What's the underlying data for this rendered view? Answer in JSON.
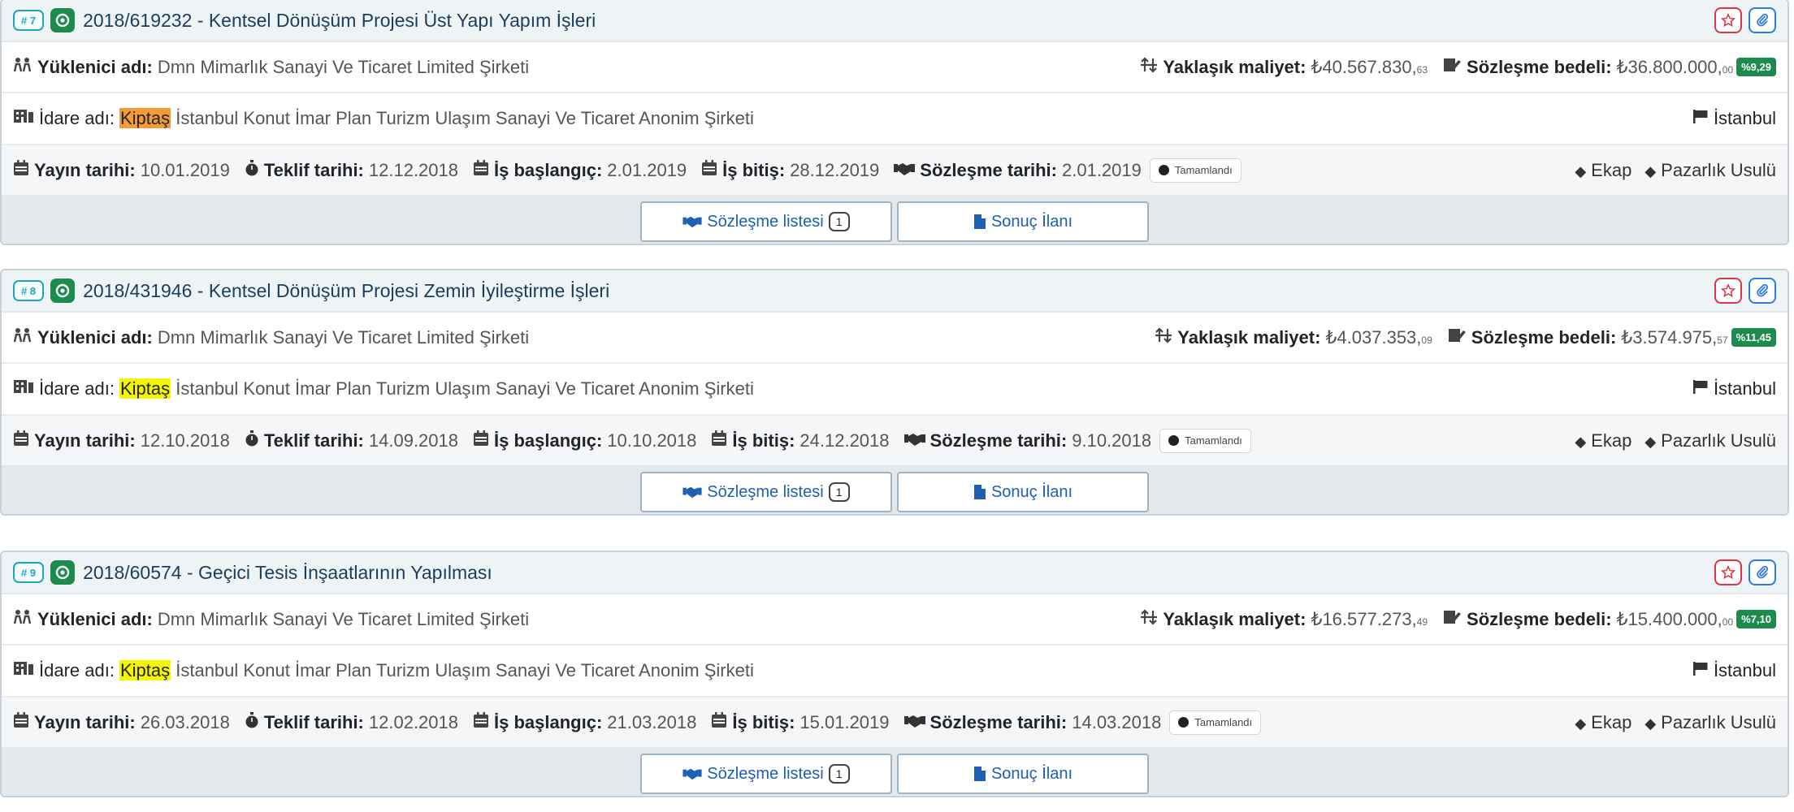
{
  "labels": {
    "contractor": "Yüklenici adı:",
    "approx_cost": "Yaklaşık maliyet:",
    "contract_price": "Sözleşme bedeli:",
    "admin": "İdare adı:",
    "pub_date": "Yayın tarihi:",
    "bid_date": "Teklif tarihi:",
    "start_date": "İş başlangıç:",
    "end_date": "İş bitiş:",
    "contract_date": "Sözleşme tarihi:",
    "contract_list_btn": "Sözleşme listesi",
    "result_btn": "Sonuç İlanı"
  },
  "icons": {
    "contractor": "people-icon",
    "approx_cost": "sort-arrows-icon",
    "contract_price": "signature-icon",
    "admin": "building-icon",
    "city": "flag-icon",
    "date": "calendar-icon",
    "bid": "stopwatch-icon",
    "contract": "handshake-icon",
    "tag": "tag-icon",
    "fav": "star-icon",
    "attach": "paperclip-icon",
    "result": "file-icon",
    "status": "check-circle-icon"
  },
  "colors": {
    "index_badge": "#1fa6b8",
    "status_icon": "#1d8a4e",
    "percent_badge": "#1d8a4e",
    "fav_button": "#dc3545",
    "attach_button": "#2f7bdc",
    "title_text": "#1b3d5c",
    "highlight_selected": "#f69a36",
    "highlight": "#f6f500"
  },
  "cards": [
    {
      "index": "# 7",
      "title": "2018/619232 - Kentsel Dönüşüm Projesi Üst Yapı Yapım İşleri",
      "contractor": "Dmn Mimarlık Sanayi Ve Ticaret Limited Şirketi",
      "approx_cost_main": "₺40.567.830,",
      "approx_cost_cents": "63",
      "contract_price_main": "₺36.800.000,",
      "contract_price_cents": "00",
      "discount_pct": "%9,29",
      "admin_highlight": "Kiptaş",
      "admin_rest": "İstanbul Konut İmar Plan Turizm Ulaşım Sanayi Ve Ticaret Anonim Şirketi",
      "city": "İstanbul",
      "pub_date": "10.01.2019",
      "bid_date": "12.12.2018",
      "start_date": "2.01.2019",
      "end_date": "28.12.2019",
      "contract_date": "2.01.2019",
      "state": "Tamamlandı",
      "tag1": "Ekap",
      "tag2": "Pazarlık Usulü",
      "contract_count": "1"
    },
    {
      "index": "# 8",
      "title": "2018/431946 - Kentsel Dönüşüm Projesi Zemin İyileştirme İşleri",
      "contractor": "Dmn Mimarlık Sanayi Ve Ticaret Limited Şirketi",
      "approx_cost_main": "₺4.037.353,",
      "approx_cost_cents": "09",
      "contract_price_main": "₺3.574.975,",
      "contract_price_cents": "57",
      "discount_pct": "%11,45",
      "admin_highlight": "Kiptaş",
      "admin_rest": "İstanbul Konut İmar Plan Turizm Ulaşım Sanayi Ve Ticaret Anonim Şirketi",
      "city": "İstanbul",
      "pub_date": "12.10.2018",
      "bid_date": "14.09.2018",
      "start_date": "10.10.2018",
      "end_date": "24.12.2018",
      "contract_date": "9.10.2018",
      "state": "Tamamlandı",
      "tag1": "Ekap",
      "tag2": "Pazarlık Usulü",
      "contract_count": "1"
    },
    {
      "index": "# 9",
      "title": "2018/60574 - Geçici Tesis İnşaatlarının Yapılması",
      "contractor": "Dmn Mimarlık Sanayi Ve Ticaret Limited Şirketi",
      "approx_cost_main": "₺16.577.273,",
      "approx_cost_cents": "49",
      "contract_price_main": "₺15.400.000,",
      "contract_price_cents": "00",
      "discount_pct": "%7,10",
      "admin_highlight": "Kiptaş",
      "admin_rest": "İstanbul Konut İmar Plan Turizm Ulaşım Sanayi Ve Ticaret Anonim Şirketi",
      "city": "İstanbul",
      "pub_date": "26.03.2018",
      "bid_date": "12.02.2018",
      "start_date": "21.03.2018",
      "end_date": "15.01.2019",
      "contract_date": "14.03.2018",
      "state": "Tamamlandı",
      "tag1": "Ekap",
      "tag2": "Pazarlık Usulü",
      "contract_count": "1"
    }
  ]
}
